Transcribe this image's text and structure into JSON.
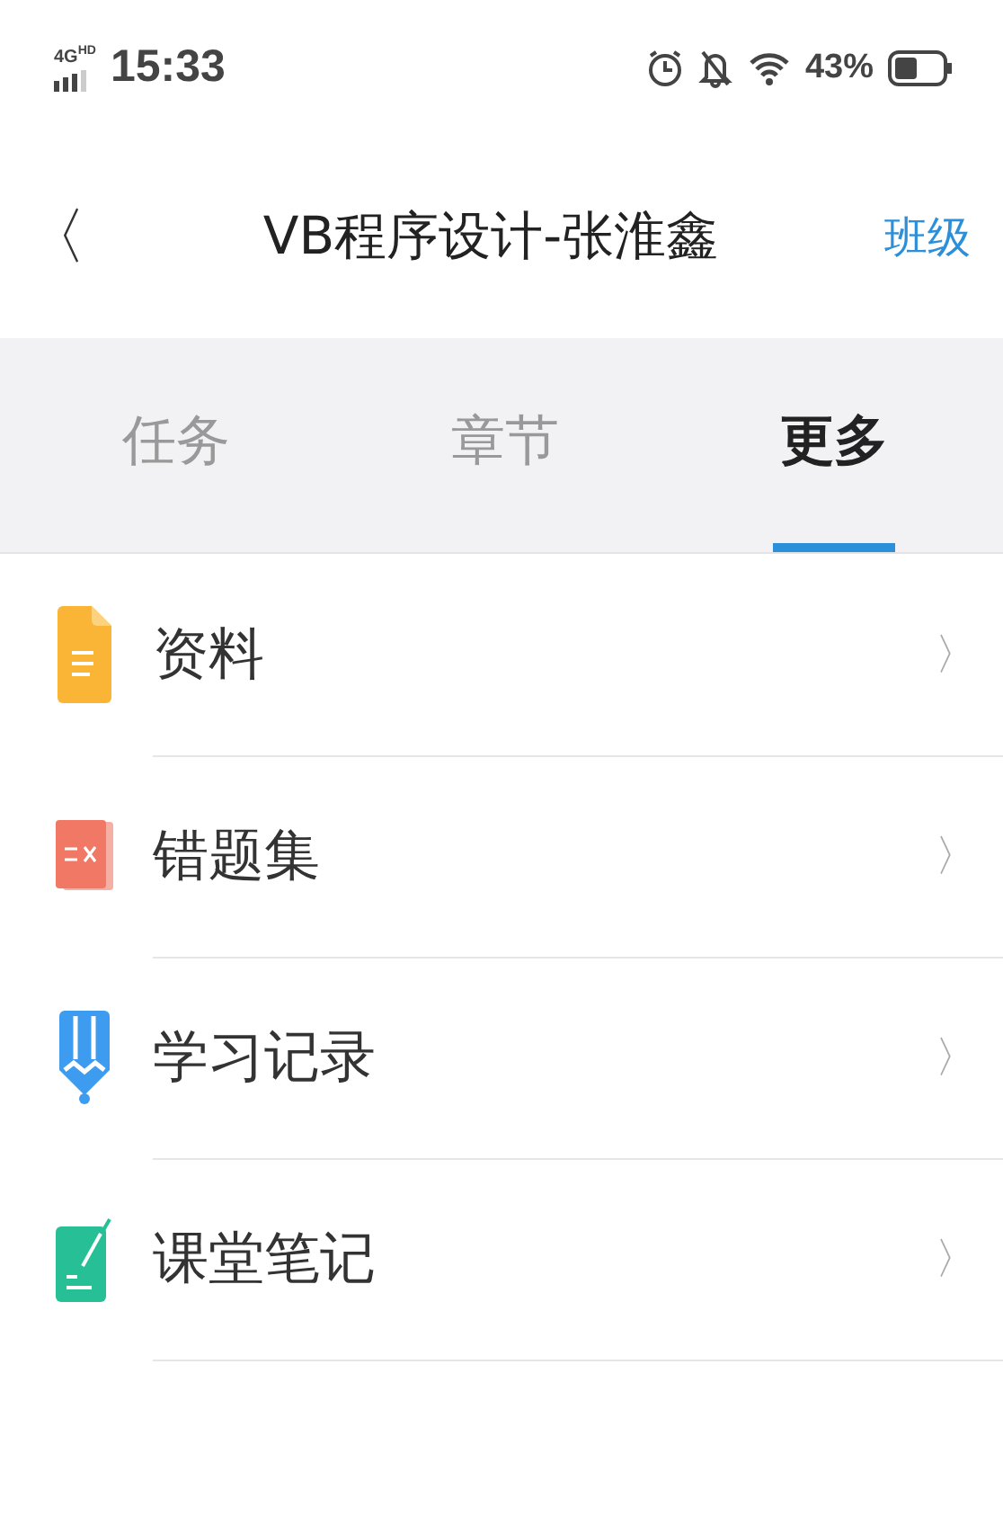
{
  "status_bar": {
    "network": "4G",
    "network_badge": "HD",
    "time": "15:33",
    "battery": "43%"
  },
  "header": {
    "back": "〈",
    "title": "VB程序设计-张淮鑫",
    "action": "班级"
  },
  "tabs": [
    {
      "label": "任务",
      "selected": false
    },
    {
      "label": "章节",
      "selected": false
    },
    {
      "label": "更多",
      "selected": true
    }
  ],
  "items": [
    {
      "label": "资料",
      "kind": "document",
      "chevron": "〉"
    },
    {
      "label": "错题集",
      "kind": "mistakes",
      "chevron": "〉"
    },
    {
      "label": "学习记录",
      "kind": "pencil",
      "chevron": "〉"
    },
    {
      "label": "课堂笔记",
      "kind": "notes",
      "chevron": "〉"
    }
  ]
}
